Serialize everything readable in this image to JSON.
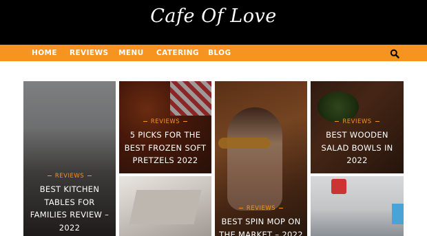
{
  "site": {
    "logo_text": "Cafe Of Love"
  },
  "nav": {
    "items": [
      {
        "label": "HOME"
      },
      {
        "label": "REVIEWS"
      },
      {
        "label": "MENU"
      },
      {
        "label": "CATERING"
      },
      {
        "label": "BLOG"
      }
    ],
    "search_icon": "search-icon"
  },
  "colors": {
    "header_bg": "#000000",
    "nav_bg": "#f5941f",
    "accent": "#f5941f"
  },
  "posts": [
    {
      "category": "REVIEWS",
      "title_lines": [
        "BEST KITCHEN",
        "TABLES FOR",
        "FAMILIES REVIEW –",
        "2022"
      ]
    },
    {
      "category": "REVIEWS",
      "title_lines": [
        "5 PICKS FOR THE",
        "BEST FROZEN SOFT",
        "PRETZELS 2022"
      ]
    },
    {
      "category": "REVIEWS",
      "title_lines": [
        "BEST SPIN MOP ON",
        "THE MARKET – 2022"
      ]
    },
    {
      "category": "REVIEWS",
      "title_lines": [
        "BEST WOODEN",
        "SALAD BOWLS IN",
        "2022"
      ]
    }
  ]
}
